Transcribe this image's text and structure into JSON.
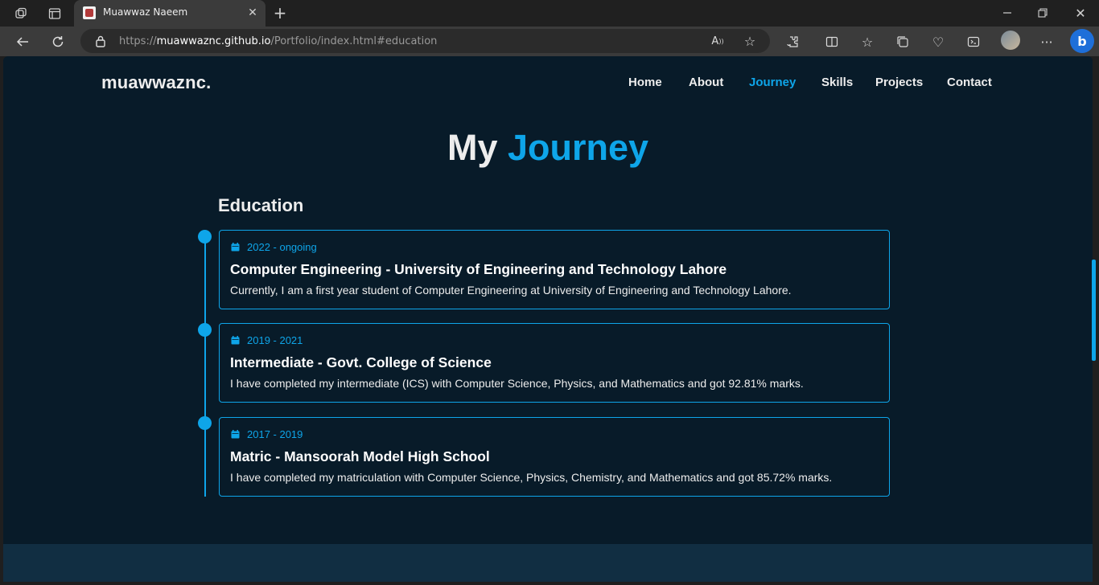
{
  "browser": {
    "tab_title": "Muawwaz Naeem",
    "url_prefix": "https://",
    "url_host": "muawwaznc.github.io",
    "url_path": "/Portfolio/index.html#education"
  },
  "site": {
    "logo": "muawwaznc.",
    "nav": [
      {
        "label": "Home"
      },
      {
        "label": "About"
      },
      {
        "label": "Journey"
      },
      {
        "label": "Skills"
      },
      {
        "label": "Projects"
      },
      {
        "label": "Contact"
      }
    ],
    "active_nav": "Journey",
    "accent_color": "#0ea5e9",
    "background_color": "#081b29"
  },
  "journey": {
    "title_plain": "My",
    "title_accent": "Journey",
    "subheading": "Education",
    "items": [
      {
        "date": "2022 - ongoing",
        "title": "Computer Engineering - University of Engineering and Technology Lahore",
        "description": "Currently, I am a first year student of Computer Engineering at University of Engineering and Technology Lahore."
      },
      {
        "date": "2019 - 2021",
        "title": "Intermediate - Govt. College of Science",
        "description": "I have completed my intermediate (ICS) with Computer Science, Physics, and Mathematics and got 92.81% marks."
      },
      {
        "date": "2017 - 2019",
        "title": "Matric - Mansoorah Model High School",
        "description": "I have completed my matriculation with Computer Science, Physics, Chemistry, and Mathematics and got 85.72% marks."
      }
    ]
  }
}
